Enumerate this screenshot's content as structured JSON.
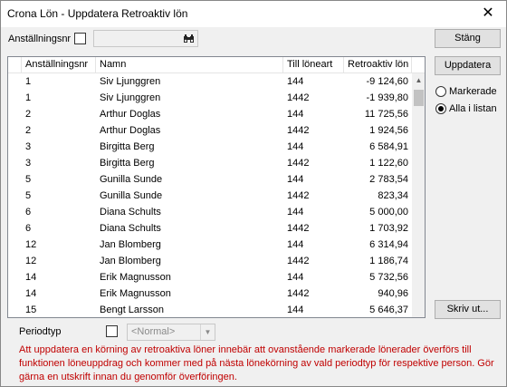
{
  "window": {
    "title": "Crona Lön - Uppdatera Retroaktiv lön",
    "close_glyph": "✕"
  },
  "filter": {
    "label": "Anställningsnr",
    "search_value": "",
    "search_icon": "binoculars-icon"
  },
  "buttons": {
    "close": "Stäng",
    "update": "Uppdatera",
    "print": "Skriv ut..."
  },
  "options": {
    "marked": "Markerade",
    "all": "Alla i listan",
    "selected": "all"
  },
  "grid": {
    "headers": [
      "Anställningsnr",
      "Namn",
      "Till löneart",
      "Retroaktiv lön"
    ],
    "rows": [
      [
        "1",
        "Siv Ljunggren",
        "144",
        "-9 124,60"
      ],
      [
        "1",
        "Siv Ljunggren",
        "1442",
        "-1 939,80"
      ],
      [
        "2",
        "Arthur Doglas",
        "144",
        "11 725,56"
      ],
      [
        "2",
        "Arthur Doglas",
        "1442",
        "1 924,56"
      ],
      [
        "3",
        "Birgitta Berg",
        "144",
        "6 584,91"
      ],
      [
        "3",
        "Birgitta Berg",
        "1442",
        "1 122,60"
      ],
      [
        "5",
        "Gunilla Sunde",
        "144",
        "2 783,54"
      ],
      [
        "5",
        "Gunilla Sunde",
        "1442",
        "823,34"
      ],
      [
        "6",
        "Diana Schults",
        "144",
        "5 000,00"
      ],
      [
        "6",
        "Diana Schults",
        "1442",
        "1 703,92"
      ],
      [
        "12",
        "Jan Blomberg",
        "144",
        "6 314,94"
      ],
      [
        "12",
        "Jan Blomberg",
        "1442",
        "1 186,74"
      ],
      [
        "14",
        "Erik Magnusson",
        "144",
        "5 732,56"
      ],
      [
        "14",
        "Erik Magnusson",
        "1442",
        "940,96"
      ],
      [
        "15",
        "Bengt Larsson",
        "144",
        "5 646,37"
      ]
    ]
  },
  "periodtyp": {
    "label": "Periodtyp",
    "value": "<Normal>"
  },
  "info": "Att uppdatera en körning av retroaktiva löner innebär att ovanstående markerade lönerader överförs till funktionen löneuppdrag och kommer med på nästa lönekörning av vald periodtyp för respektive person. Gör gärna en utskrift innan du genomför överföringen."
}
